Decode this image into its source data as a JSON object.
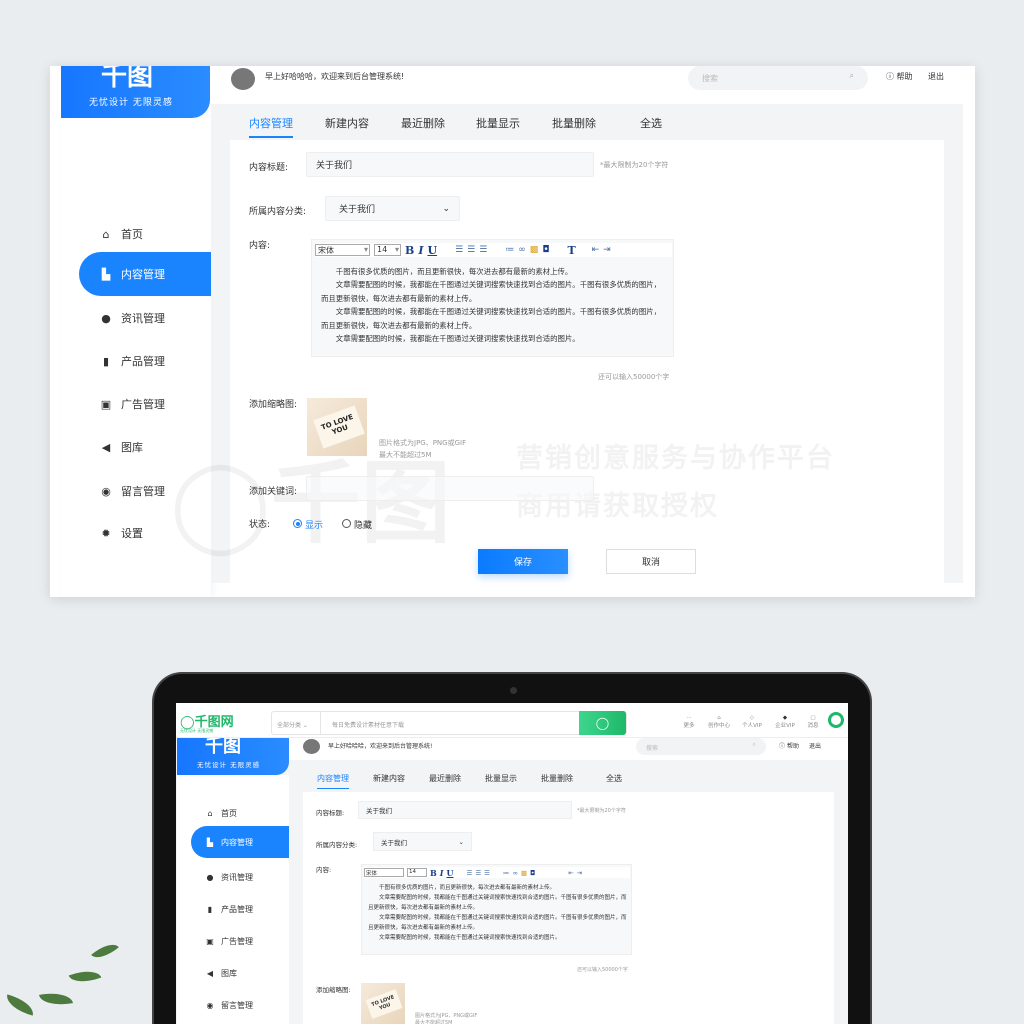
{
  "brand": {
    "logo_text": "千图",
    "slogan": "无忧设计 无限灵感"
  },
  "header": {
    "greeting": "早上好哈哈哈，欢迎来到后台管理系统!",
    "search_placeholder": "搜索",
    "help": "帮助",
    "logout": "退出"
  },
  "sidebar": {
    "items": [
      {
        "label": "首页",
        "icon": "home-icon"
      },
      {
        "label": "内容管理",
        "icon": "building-icon",
        "active": true
      },
      {
        "label": "资讯管理",
        "icon": "users-icon"
      },
      {
        "label": "产品管理",
        "icon": "book-icon"
      },
      {
        "label": "广告管理",
        "icon": "ad-icon"
      },
      {
        "label": "图库",
        "icon": "megaphone-icon"
      },
      {
        "label": "留言管理",
        "icon": "message-icon"
      },
      {
        "label": "设置",
        "icon": "gear-icon"
      }
    ]
  },
  "tabs": [
    {
      "label": "内容管理",
      "active": true
    },
    {
      "label": "新建内容"
    },
    {
      "label": "最近删除"
    },
    {
      "label": "批量显示"
    },
    {
      "label": "批量删除"
    },
    {
      "label": "全选"
    }
  ],
  "form": {
    "title_label": "内容标题:",
    "title_value": "关于我们",
    "title_hint": "*最大限制为20个字符",
    "category_label": "所属内容分类:",
    "category_value": "关于我们",
    "content_label": "内容:",
    "editor": {
      "font": "宋体",
      "size": "14",
      "paragraphs": [
        "千图有很多优质的图片，而且更新很快，每次进去都有最新的素材上传。",
        "文章需要配图的时候，我都能在千图通过关键词搜索快速找到合适的图片。千图有很多优质的图片，而且更新很快，每次进去都有最新的素材上传。",
        "文章需要配图的时候，我都能在千图通过关键词搜索快速找到合适的图片。千图有很多优质的图片，而且更新很快，每次进去都有最新的素材上传。",
        "文章需要配图的时候，我都能在千图通过关键词搜索快速找到合适的图片。"
      ]
    },
    "remaining": "还可以输入50000个字",
    "thumb_label": "添加缩略图:",
    "thumb_image_text": "TO LOVE YOU",
    "thumb_hint1": "图片格式为JPG、PNG或GIF",
    "thumb_hint2": "最大不能超过5M",
    "keyword_label": "添加关键词:",
    "keyword_value": "",
    "status_label": "状态:",
    "status_options": [
      {
        "label": "显示",
        "checked": true
      },
      {
        "label": "隐藏",
        "checked": false
      }
    ],
    "save": "保存",
    "cancel": "取消"
  },
  "watermark": {
    "line1": "营销创意服务与协作平台",
    "line2": "商用请获取授权"
  },
  "site_bar": {
    "logo": "千图网",
    "slogan": "无忧设计 无限灵感",
    "category": "全部分类",
    "search_placeholder": "每日免费设计素材任意下载",
    "items": [
      "更多",
      "创作中心",
      "个人VIP",
      "企业VIP",
      "消息"
    ]
  },
  "colors": {
    "accent": "#1a84ff",
    "site_green": "#1fb86a"
  }
}
